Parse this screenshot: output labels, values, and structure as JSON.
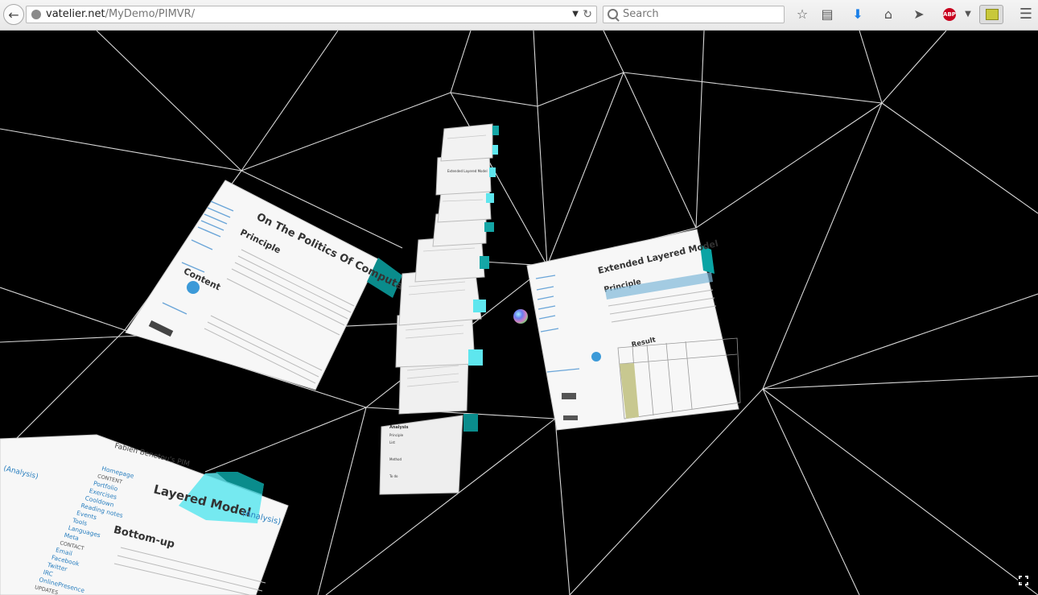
{
  "browser": {
    "url_domain": "vatelier.net",
    "url_path": "/MyDemo/PIMVR/",
    "search_placeholder": "Search",
    "adblock_label": "ABP"
  },
  "scene": {
    "page_left": {
      "title": "On The Politics Of Computations",
      "heading": "Principle",
      "section": "Content",
      "analysis_label": "(Analysis)"
    },
    "page_right": {
      "title": "Extended Layered Model",
      "heading": "Principle",
      "section": "Result"
    },
    "page_bottom": {
      "site": "Fabien Benetou's PIM",
      "title": "Layered Model",
      "analysis_label": "(Analysis)",
      "heading": "Bottom-up",
      "sidebar_items": [
        "Homepage",
        "CONTENT",
        "Portfolio",
        "Exercises",
        "Cooldown",
        "Reading notes",
        "Events",
        "Tools",
        "Languages",
        "Meta",
        "CONTACT",
        "Email",
        "Facebook",
        "Twitter",
        "IRC",
        "OnlinePresence",
        "UPDATES"
      ]
    },
    "stack_top_label": "Extended Layered Model",
    "stack_bottom_label": "Analysis",
    "stack_bottom_sub": "Principle",
    "stack_bottom_list": "List",
    "stack_bottom_method": "Method",
    "stack_bottom_todo": "To do"
  },
  "colors": {
    "accent_cyan": "#5ee6ee",
    "tab_teal": "#0a8c8c",
    "wire": "#d8d8d8",
    "link": "#2a7fbf"
  }
}
